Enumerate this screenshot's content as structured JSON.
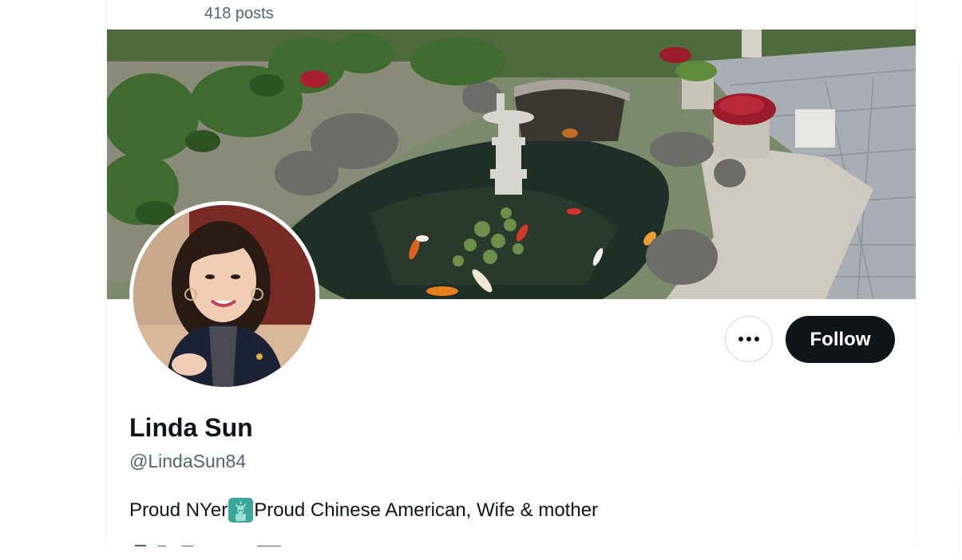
{
  "header": {
    "post_count": "418 posts"
  },
  "profile": {
    "display_name": "Linda Sun",
    "handle": "@LindaSun84",
    "bio_before_emoji": "Proud NYer",
    "bio_emoji": "statue-of-liberty-icon",
    "bio_after_emoji": "Proud Chinese American, Wife & mother"
  },
  "actions": {
    "more_icon": "more-dots-icon",
    "follow_label": "Follow"
  },
  "colors": {
    "text_primary": "#0f1419",
    "text_secondary": "#536471",
    "follow_bg": "#0f1419",
    "border": "#cfd9de"
  }
}
